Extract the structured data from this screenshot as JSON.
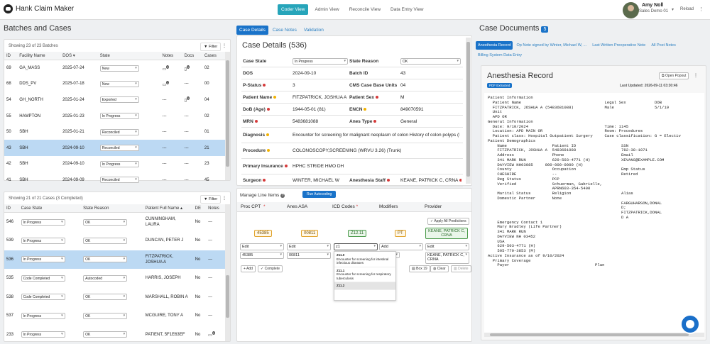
{
  "app": {
    "title": "Hank Claim Maker"
  },
  "nav": [
    "Coder View",
    "Admin View",
    "Reconcile View",
    "Data Entry View"
  ],
  "user": {
    "name": "Amy Noll",
    "role": "Sales Demo 01",
    "reload": "Reload"
  },
  "batches": {
    "heading": "Batches and Cases",
    "showing": "Showing 23 of 23 Batches",
    "filter": "Filter",
    "columns": [
      "ID",
      "Facility Name",
      "DOS",
      "State",
      "Notes",
      "Docs",
      "Cases"
    ],
    "rows": [
      {
        "id": "69",
        "facility": "GA_MASS",
        "dos": "2025-07-24",
        "state": "New",
        "notes": "2",
        "docs": "1",
        "cases": "02"
      },
      {
        "id": "68",
        "facility": "DDS_PV",
        "dos": "2025-07-18",
        "state": "New",
        "notes": "1",
        "docs": "---",
        "cases": "00"
      },
      {
        "id": "54",
        "facility": "GH_NORTH",
        "dos": "2025-01-24",
        "state": "Exported",
        "notes": "---",
        "docs": "1",
        "cases": "04"
      },
      {
        "id": "55",
        "facility": "HAMPTON",
        "dos": "2025-01-23",
        "state": "In Progress",
        "notes": "---",
        "docs": "---",
        "cases": "02"
      },
      {
        "id": "50",
        "facility": "SBH",
        "dos": "2025-01-21",
        "state": "Reconciled",
        "notes": "---",
        "docs": "---",
        "cases": "01"
      },
      {
        "id": "43",
        "facility": "SBH",
        "dos": "2024-09-10",
        "state": "Reconciled",
        "notes": "---",
        "docs": "---",
        "cases": "21"
      },
      {
        "id": "42",
        "facility": "SBH",
        "dos": "2024-09-10",
        "state": "In Progress",
        "notes": "---",
        "docs": "---",
        "cases": "23"
      },
      {
        "id": "41",
        "facility": "SBH",
        "dos": "2024-09-09",
        "state": "Reconciled",
        "notes": "---",
        "docs": "---",
        "cases": "45"
      }
    ]
  },
  "cases": {
    "showing": "Showing 21 of 21 Cases (3 Completed)",
    "filter": "Filter",
    "columns": [
      "ID",
      "Case State",
      "State Reason",
      "Patient Full Name",
      "DE",
      "Notes"
    ],
    "rows": [
      {
        "id": "546",
        "state": "In Progress",
        "reason": "OK",
        "name": "CUNNINGHAM, LAURA",
        "de": "No",
        "notes": "---"
      },
      {
        "id": "539",
        "state": "In Progress",
        "reason": "OK",
        "name": "DUNCAN, PETER J",
        "de": "No",
        "notes": "---"
      },
      {
        "id": "536",
        "state": "In Progress",
        "reason": "OK",
        "name": "FITZPATRICK, JOSHUA A",
        "de": "No",
        "notes": "---"
      },
      {
        "id": "535",
        "state": "Code Completed",
        "reason": "Autocoded",
        "name": "HARRIS, JOSEPH",
        "de": "No",
        "notes": "---"
      },
      {
        "id": "538",
        "state": "Code Completed",
        "reason": "OK",
        "name": "MARSHALL, ROBIN A",
        "de": "No",
        "notes": "---"
      },
      {
        "id": "537",
        "state": "In Progress",
        "reason": "OK",
        "name": "MCGUIRE, TONY A",
        "de": "No",
        "notes": "---"
      },
      {
        "id": "233",
        "state": "In Progress",
        "reason": "OK",
        "name": "PATIENT, 5F1E63EF",
        "de": "No",
        "notes": "1"
      }
    ]
  },
  "case_tabs": [
    "Case Details",
    "Case Notes",
    "Validation"
  ],
  "case_details": {
    "title": "Case Details (536)",
    "case_state_label": "Case State",
    "case_state": "In Progress",
    "state_reason_label": "State Reason",
    "state_reason": "OK",
    "dos_label": "DOS",
    "dos": "2024-09-10",
    "batch_id_label": "Batch ID",
    "batch_id": "43",
    "pstatus_label": "P-Status",
    "pstatus": "3",
    "cms_label": "CMS Case Base Units",
    "cms": "04",
    "patient_name_label": "Patient Name",
    "patient_name": "FITZPATRICK, JOSHUA A",
    "patient_sex_label": "Patient Sex",
    "patient_sex": "M",
    "dob_label": "DoB (Age)",
    "dob": "1944-05-01 (81)",
    "encn_label": "ENCN",
    "encn": "849070591",
    "mrn_label": "MRN",
    "mrn": "5483681088",
    "anes_type_label": "Anes Type",
    "anes_type": "General",
    "diagnosis_label": "Diagnosis",
    "diagnosis": "Encounter for screening for malignant neoplasm of colon History of colon polyps (E...",
    "procedure_label": "Procedure",
    "procedure": "COLONOSCOPY,SCREENING (WRVU 3.26) (Trunk)",
    "insurance_label": "Primary Insurance",
    "insurance": "HPHC STRIDE HMO DH",
    "surgeon_label": "Surgeon",
    "surgeon": "WINTER, MICHAEL W",
    "anes_staff_label": "Anesthesia Staff",
    "anes_staff": "KEANE, PATRICK C, CRNA"
  },
  "line_items": {
    "title": "Manage Line Items",
    "autocode": "Run Autocoding",
    "columns": [
      "Proc CPT",
      "Anes ASA",
      "ICD Codes",
      "Modifiers",
      "Provider"
    ],
    "apply_all": "Apply All Predictions",
    "pred_cpt": "45385",
    "pred_asa": "00811",
    "pred_icd": "Z12.11",
    "pred_mod": "PT",
    "pred_provider": "KEANE, PATRICK C, CRNA",
    "edit": "Edit",
    "add_ph": "Add",
    "icd_input": "z1",
    "cpt_val": "45385",
    "asa_val": "00811",
    "provider_val": "KEANE, PATRICK C, CRNA",
    "add_btn": "Add",
    "complete_btn": "Complete",
    "box19": "Box 19",
    "clear": "Clear",
    "delete": "Delete",
    "suggestions": [
      {
        "code": "Z11.0",
        "desc": "Encounter for screening for intestinal infectious diseases"
      },
      {
        "code": "Z11.1",
        "desc": "Encounter for screening for respiratory tuberculosis"
      },
      {
        "code": "Z11.2",
        "desc": ""
      }
    ]
  },
  "docs": {
    "heading": "Case Documents",
    "count": "5",
    "tabs": [
      "Anesthesia Record",
      "Op Note signed by Winter, Michael W, ...",
      "Last Written Preoperative Note",
      "All Post Notes",
      "Billing System Data Entry"
    ],
    "doc_title": "Anesthesia Record",
    "badge": "PDF Extracted",
    "open_popout": "Open Popout",
    "updated": "Last Updated: 2026-09-11 03:30:46",
    "text": "Patient Information\n  Patient Name                                   Legal Sex            DOB\n  FITZPATRICK, JOSHUA A (5483681088)             Male                 5/1/19\n  Unit\n  APD OR\nGeneral Information\n  Date: 9/10/2024                                Time: 1145\n  Location: APD MAIN OR                          Room: Procedures\n  Patient class: Hospital Outpatient Surgery     Case classification: G = Electiv\nPatient Demographics\n    Name                   Patient ID                   SSN\n    FITZPATRICK, JOSHUA A  5483681088                   782-38-1071\n    Address                Phone                        Email\n    341 MARK RUN           629-503-4771 (H)             XEVANS@EXAMPLE.COM\n    DAYVIEW NH03085     000-000-0000 (H)\n    County                 Occupation                   Emp Status\n    CHESHIRE               --                           Retired\n    Reg Status             PCP\n    Verified               Schuerman, Gabrielle,\n                           APRN603-354-5400\n    Marital Status         Religion                     Alias\n    Domestic Partner       None\n                                                        FARGUHARSON,DONAL\n                                                        D;\n                                                        FITZPATRICK,DONAL\n                                                        D A\n    Emergency Contact 1\n    Mary Bradley (Life Partner)\n    341 MARK RUN\n    DAYVIEW NH 03452\n    USA\n    629-503-4771 (H)\n    505-770-3853 (M)\nActive Insurance as of 9/10/2024\n  Primary Coverage\n    Payor                                    Plan"
  }
}
